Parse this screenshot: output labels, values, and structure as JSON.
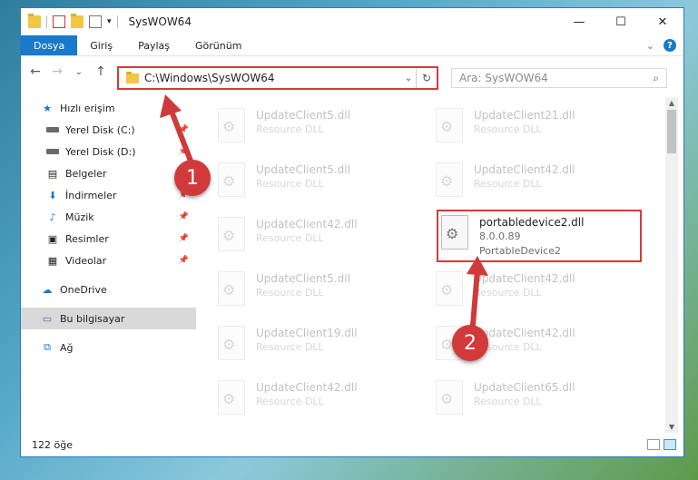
{
  "window": {
    "title": "SysWOW64",
    "minimize": "—",
    "maximize": "☐",
    "close": "✕"
  },
  "ribbon": {
    "tabs": [
      "Dosya",
      "Giriş",
      "Paylaş",
      "Görünüm"
    ],
    "help": "?"
  },
  "nav": {
    "back": "←",
    "forward": "→",
    "recent": "⌄",
    "up": "↑"
  },
  "address": {
    "path": "C:\\Windows\\SysWOW64"
  },
  "search": {
    "placeholder": "Ara: SysWOW64"
  },
  "sidebar": {
    "items": [
      {
        "label": "Hızlı erişim",
        "icon": "star-icon"
      },
      {
        "label": "Yerel Disk (C:)",
        "icon": "drive-icon"
      },
      {
        "label": "Yerel Disk (D:)",
        "icon": "drive-icon"
      },
      {
        "label": "Belgeler",
        "icon": "document-icon"
      },
      {
        "label": "İndirmeler",
        "icon": "download-icon"
      },
      {
        "label": "Müzik",
        "icon": "music-icon"
      },
      {
        "label": "Resimler",
        "icon": "pictures-icon"
      },
      {
        "label": "Videolar",
        "icon": "video-icon"
      },
      {
        "label": "OneDrive",
        "icon": "cloud-icon"
      },
      {
        "label": "Bu bilgisayar",
        "icon": "computer-icon"
      },
      {
        "label": "Ağ",
        "icon": "network-icon"
      }
    ]
  },
  "files": [
    {
      "name": "UpdateClient5.dll",
      "sub": "Resource DLL"
    },
    {
      "name": "UpdateClient21.dll",
      "sub": "Resource DLL"
    },
    {
      "name": "UpdateClient5.dll",
      "sub": "Resource DLL"
    },
    {
      "name": "UpdateClient42.dll",
      "sub": "Resource DLL"
    },
    {
      "name": "UpdateClient42.dll",
      "sub": "Resource DLL"
    },
    {
      "name": "portabledevice2.dll",
      "sub": "8.0.0.89",
      "sub2": "PortableDevice2"
    },
    {
      "name": "UpdateClient5.dll",
      "sub": "Resource DLL"
    },
    {
      "name": "UpdateClient42.dll",
      "sub": "Resource DLL"
    },
    {
      "name": "UpdateClient19.dll",
      "sub": "Resource DLL"
    },
    {
      "name": "UpdateClient42.dll",
      "sub": "Resource DLL"
    },
    {
      "name": "UpdateClient42.dll",
      "sub": "Resource DLL"
    },
    {
      "name": "UpdateClient65.dll",
      "sub": "Resource DLL"
    }
  ],
  "status": {
    "count": "122 öğe"
  },
  "callouts": {
    "one": "1",
    "two": "2"
  },
  "colors": {
    "accent": "#1979ca",
    "callout": "#d03a3a"
  }
}
